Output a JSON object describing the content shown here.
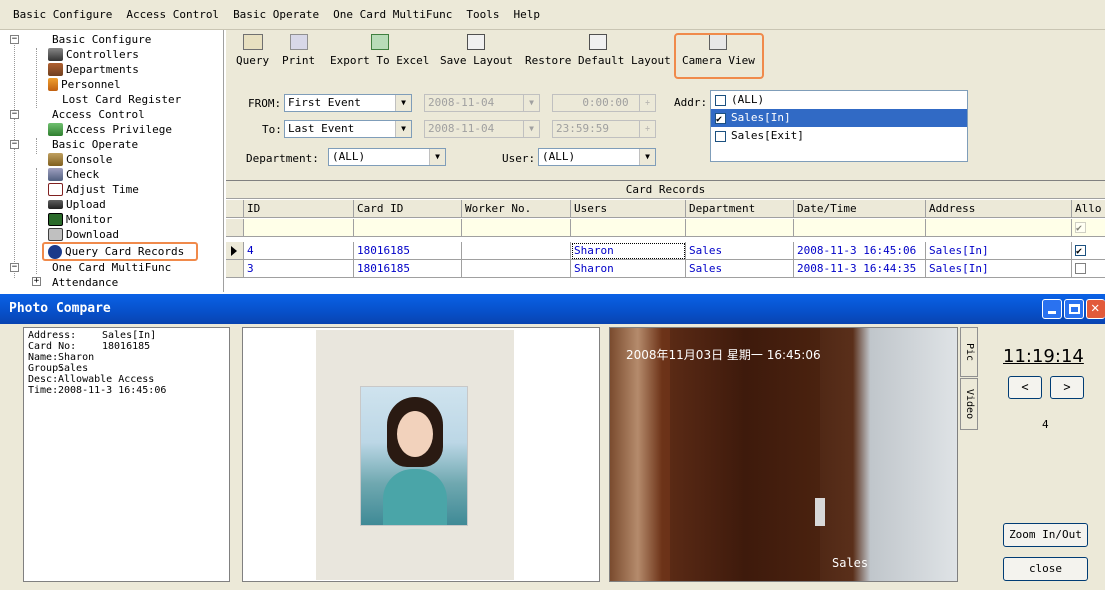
{
  "menu": [
    "Basic Configure",
    "Access Control",
    "Basic Operate",
    "One Card MultiFunc",
    "Tools",
    "Help"
  ],
  "tree": [
    {
      "label": "Basic Configure",
      "icon": "folder-icon"
    },
    {
      "label": "Controllers",
      "icon": "controllers-icon"
    },
    {
      "label": "Departments",
      "icon": "departments-icon"
    },
    {
      "label": "Personnel",
      "icon": "personnel-icon"
    },
    {
      "label": "Lost Card Register",
      "icon": ""
    },
    {
      "label": "Access Control",
      "icon": "folder-icon"
    },
    {
      "label": "Access Privilege",
      "icon": "privilege-icon"
    },
    {
      "label": "Basic Operate",
      "icon": "folder-icon"
    },
    {
      "label": "Console",
      "icon": "console-icon"
    },
    {
      "label": "Check",
      "icon": "check-icon"
    },
    {
      "label": "Adjust Time",
      "icon": "adjust-time-icon"
    },
    {
      "label": "Upload",
      "icon": "upload-icon"
    },
    {
      "label": "Monitor",
      "icon": "monitor-icon"
    },
    {
      "label": "Download",
      "icon": "download-icon"
    },
    {
      "label": "Query Card Records",
      "icon": "query-card-records-icon"
    },
    {
      "label": "One Card MultiFunc",
      "icon": "folder-icon"
    },
    {
      "label": "Attendance",
      "icon": ""
    }
  ],
  "toolbar": [
    "Query",
    "Print",
    "Export To Excel",
    "Save Layout",
    "Restore Default Layout",
    "Camera View"
  ],
  "filter": {
    "from_label": "FROM:",
    "from_value": "First Event",
    "from_date": "2008-11-04",
    "from_time": "0:00:00",
    "to_label": "To:",
    "to_value": "Last Event",
    "to_date": "2008-11-04",
    "to_time": "23:59:59",
    "department_label": "Department:",
    "department_value": "(ALL)",
    "user_label": "User:",
    "user_value": "(ALL)",
    "addr_label": "Addr:",
    "addr_items": [
      {
        "label": "(ALL)",
        "checked": false,
        "selected": false
      },
      {
        "label": "Sales[In]",
        "checked": true,
        "selected": true
      },
      {
        "label": "Sales[Exit]",
        "checked": false,
        "selected": false
      }
    ]
  },
  "grid": {
    "caption": "Card Records",
    "columns": [
      "ID",
      "Card ID",
      "Worker No.",
      "Users",
      "Department",
      "Date/Time",
      "Address",
      "Allo"
    ],
    "rows": [
      {
        "id": "4",
        "card_id": "18016185",
        "worker_no": "",
        "user": "Sharon",
        "department": "Sales",
        "datetime": "2008-11-3 16:45:06",
        "address": "Sales[In]",
        "allowed": true
      },
      {
        "id": "3",
        "card_id": "18016185",
        "worker_no": "",
        "user": "Sharon",
        "department": "Sales",
        "datetime": "2008-11-3 16:44:35",
        "address": "Sales[In]",
        "allowed": false
      }
    ]
  },
  "photo_compare": {
    "title": "Photo Compare",
    "info": [
      {
        "k": "Address:",
        "v": "Sales[In]"
      },
      {
        "k": "Card No:",
        "v": "18016185"
      },
      {
        "k": "Name:",
        "v": "Sharon"
      },
      {
        "k": "Group:",
        "v": "Sales"
      },
      {
        "k": "Desc:",
        "v": "Allowable Access"
      },
      {
        "k": "Time:",
        "v": "2008-11-3 16:45:06"
      }
    ],
    "camera_timestamp": "2008年11月03日 星期一 16:45:06",
    "camera_label": "Sales",
    "tab_pic": "Pic",
    "tab_video": "Video",
    "clock": "11:19:14",
    "prev": "<",
    "next": ">",
    "index": "4",
    "zoom_label": "Zoom In/Out",
    "close_label": "close"
  },
  "colors": {
    "highlight_box": "#f08a4b",
    "selection": "#316ac5",
    "title_bar": "#0a62e6",
    "grid_text": "#0000c8"
  }
}
